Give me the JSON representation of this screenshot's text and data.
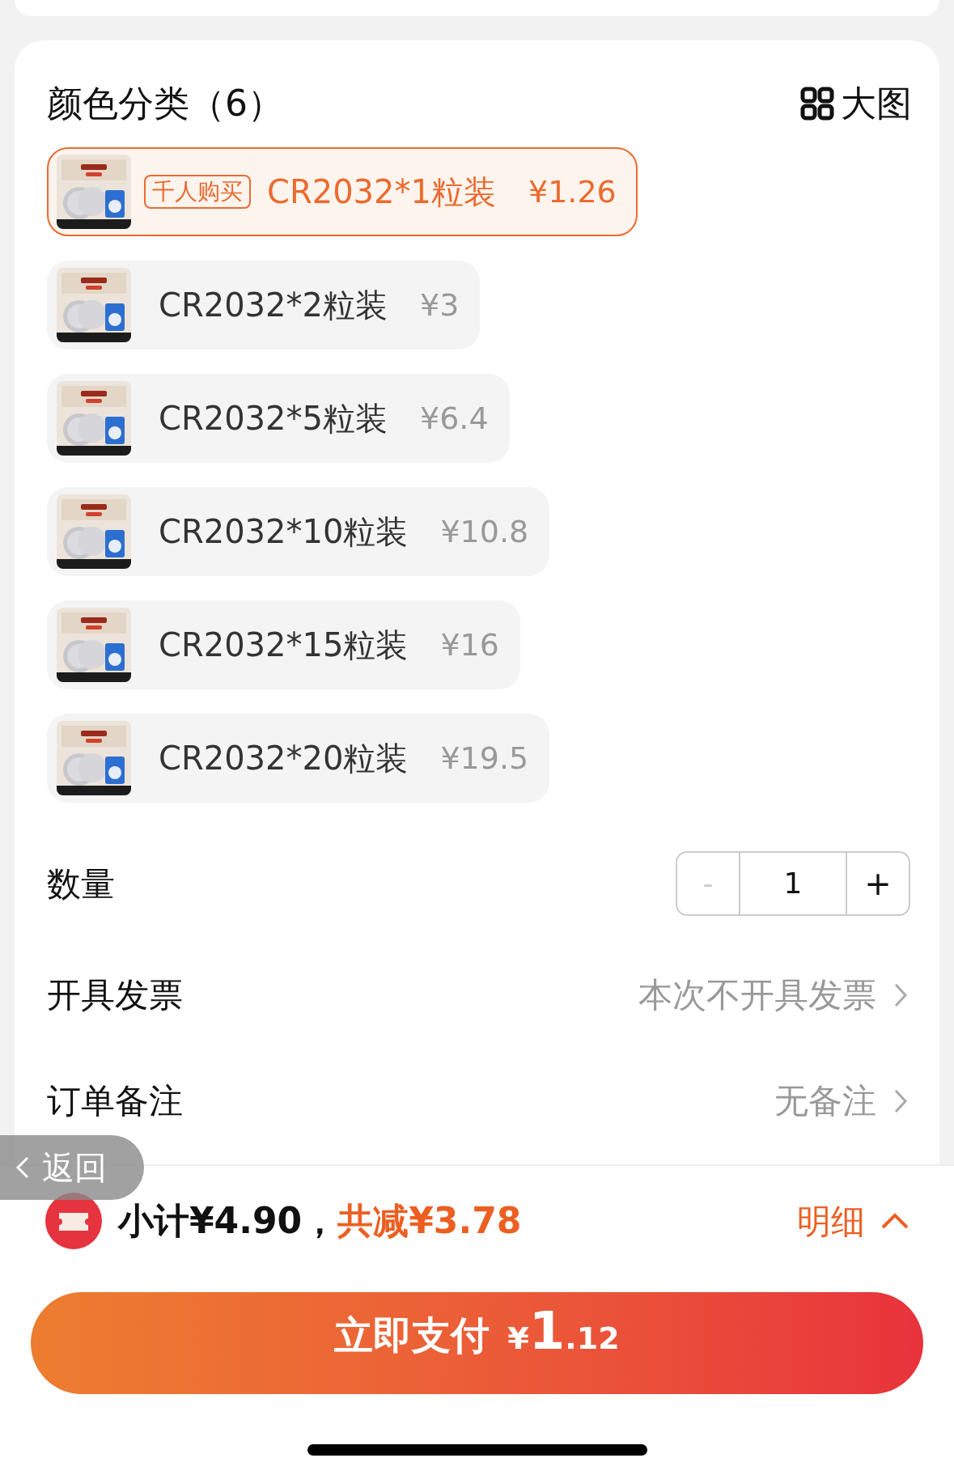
{
  "sku": {
    "title": "颜色分类（6）",
    "view_toggle": "大图",
    "options": [
      {
        "tag": "千人购买",
        "name": "CR2032*1粒装",
        "price": "¥1.26",
        "selected": true
      },
      {
        "name": "CR2032*2粒装",
        "price": "¥3",
        "selected": false
      },
      {
        "name": "CR2032*5粒装",
        "price": "¥6.4",
        "selected": false
      },
      {
        "name": "CR2032*10粒装",
        "price": "¥10.8",
        "selected": false
      },
      {
        "name": "CR2032*15粒装",
        "price": "¥16",
        "selected": false
      },
      {
        "name": "CR2032*20粒装",
        "price": "¥19.5",
        "selected": false
      }
    ]
  },
  "quantity": {
    "label": "数量",
    "minus": "-",
    "value": "1",
    "plus": "+",
    "minus_disabled": true
  },
  "rows": [
    {
      "label": "开具发票",
      "value": "本次不开具发票"
    },
    {
      "label": "订单备注",
      "value": "无备注"
    }
  ],
  "back_button": "返回",
  "summary": {
    "subtotal": "小计¥4.90，",
    "discount": "共减¥3.78",
    "details": "明细"
  },
  "pay_button": {
    "label": "立即支付",
    "currency": "¥",
    "integer": "1",
    "decimal": ".12"
  }
}
